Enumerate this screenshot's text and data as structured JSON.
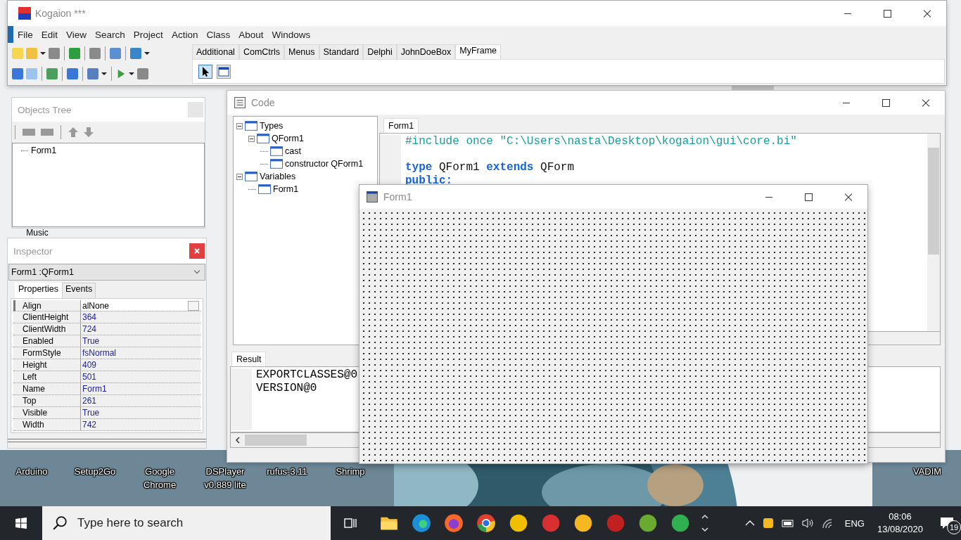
{
  "main_window": {
    "title": "Kogaion ***",
    "menu": [
      "File",
      "Edit",
      "View",
      "Search",
      "Project",
      "Action",
      "Class",
      "About",
      "Windows"
    ],
    "palette_tabs": [
      {
        "label": "Additional",
        "selected": false
      },
      {
        "label": "ComCtrls",
        "selected": false
      },
      {
        "label": "Menus",
        "selected": false
      },
      {
        "label": "Standard",
        "selected": false
      },
      {
        "label": "Delphi",
        "selected": false
      },
      {
        "label": "JohnDoeBox",
        "selected": false
      },
      {
        "label": "MyFrame",
        "selected": true
      }
    ]
  },
  "desktop_icons": [
    {
      "label": "Music"
    },
    {
      "label": "Arduino"
    },
    {
      "label": "Setup2Go"
    },
    {
      "label": "Google Chrome"
    },
    {
      "label": "DSPlayer v0.889 lite"
    },
    {
      "label": "rufus-3.11"
    },
    {
      "label": "Shrimp"
    },
    {
      "label": "VADIM"
    }
  ],
  "objects_tree": {
    "title": "Objects Tree",
    "items": [
      {
        "label": "Form1"
      }
    ]
  },
  "inspector": {
    "title": "Inspector",
    "object": "Form1 :QForm1",
    "tabs": [
      {
        "label": "Properties",
        "selected": true
      },
      {
        "label": "Events",
        "selected": false
      }
    ],
    "properties": [
      {
        "name": "Align",
        "value": "alNone",
        "kind": "dropdown"
      },
      {
        "name": "ClientHeight",
        "value": "364",
        "kind": "text"
      },
      {
        "name": "ClientWidth",
        "value": "724",
        "kind": "text"
      },
      {
        "name": "Enabled",
        "value": "True",
        "kind": "text"
      },
      {
        "name": "FormStyle",
        "value": "fsNormal",
        "kind": "text"
      },
      {
        "name": "Height",
        "value": "409",
        "kind": "text"
      },
      {
        "name": "Left",
        "value": "501",
        "kind": "text"
      },
      {
        "name": "Name",
        "value": "Form1",
        "kind": "text"
      },
      {
        "name": "Top",
        "value": "261",
        "kind": "text"
      },
      {
        "name": "Visible",
        "value": "True",
        "kind": "text"
      },
      {
        "name": "Width",
        "value": "742",
        "kind": "text"
      }
    ]
  },
  "code_window": {
    "title": "Code",
    "tree": [
      {
        "label": "Types",
        "expanded": true,
        "children": [
          {
            "label": "QForm1",
            "expanded": true,
            "children": [
              {
                "label": "cast"
              },
              {
                "label": "constructor QForm1"
              }
            ]
          }
        ]
      },
      {
        "label": "Variables",
        "expanded": true,
        "children": [
          {
            "label": "Form1"
          }
        ]
      }
    ],
    "editor_tabs": [
      {
        "label": "Form1",
        "selected": true
      }
    ],
    "code_lines": [
      {
        "tokens": [
          {
            "kind": "directive",
            "text": "#include once \"C:\\Users\\nasta\\Desktop\\kogaion\\gui\\core.bi\""
          }
        ]
      },
      {
        "tokens": [
          {
            "kind": "keyword",
            "text": "type"
          },
          {
            "kind": "plain",
            "text": "QForm1"
          },
          {
            "kind": "keyword",
            "text": "extends"
          },
          {
            "kind": "plain",
            "text": "QForm"
          }
        ]
      },
      {
        "tokens": [
          {
            "kind": "keyword",
            "text": "public:"
          }
        ]
      }
    ],
    "result_tabs": [
      {
        "label": "Result",
        "selected": true
      }
    ],
    "result_lines": [
      "EXPORTCLASSES@0",
      "VERSION@0"
    ]
  },
  "form_window": {
    "title": "Form1"
  },
  "taskbar": {
    "search_placeholder": "Type here to search",
    "language": "ENG",
    "time": "08:06",
    "date": "13/08/2020",
    "notification_count": "19"
  }
}
